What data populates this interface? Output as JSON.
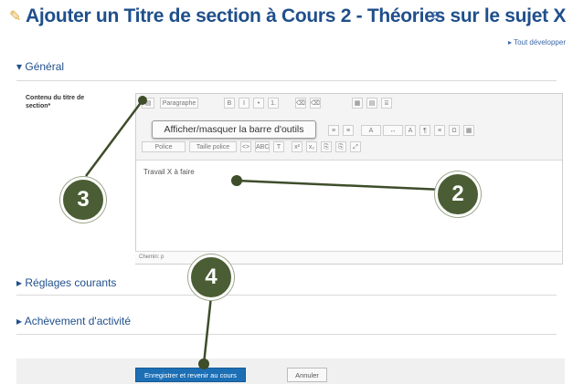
{
  "header": {
    "title": "Ajouter un Titre de section à Cours 2 - Théories sur le sujet X",
    "icon": "pencil-icon",
    "help_icon": "help-icon",
    "expand_all": "▸ Tout développer"
  },
  "sections": {
    "general": "Général",
    "settings": "Réglages courants",
    "completion": "Achèvement d'activité"
  },
  "form": {
    "field_label": "Contenu du titre de section*"
  },
  "editor": {
    "toolbar_row1": [
      "Paragraphe",
      "B",
      "I",
      "•",
      "1.",
      "⌫",
      "⌫",
      "▦",
      "▤",
      "⌸"
    ],
    "toolbar_row2": [
      "≡",
      "≡",
      "A",
      "↔",
      "A",
      "¶",
      "≡",
      "Ω",
      "▦"
    ],
    "toolbar_row3": [
      "Police",
      "Taille police",
      "<>",
      "ABC",
      "T",
      "x²",
      "x₂",
      "⎘",
      "⎘",
      "⤢"
    ],
    "tooltip": "Afficher/masquer la barre d'outils",
    "content": "Travail X à faire",
    "path": "Chemin: p"
  },
  "buttons": {
    "save": "Enregistrer et revenir au cours",
    "cancel": "Annuler"
  },
  "markers": {
    "m2": "2",
    "m3": "3",
    "m4": "4"
  },
  "colors": {
    "title": "#1f4f8b",
    "marker": "#4b5d34",
    "primary_button": "#1c6fb5"
  }
}
